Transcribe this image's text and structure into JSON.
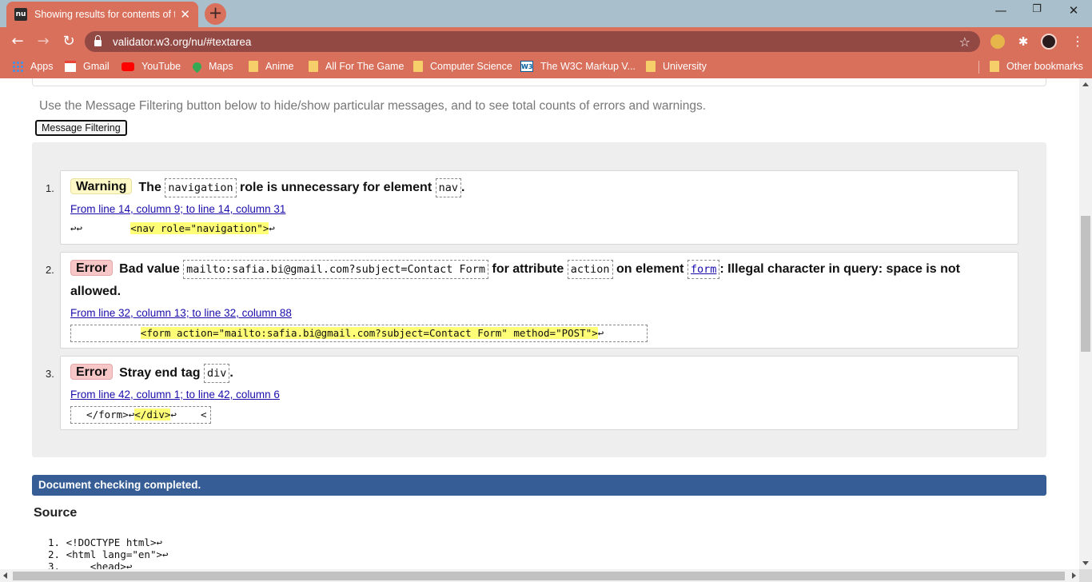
{
  "browser": {
    "tab_title": "Showing results for contents of text-input area",
    "tab_favicon_text": "nu",
    "url": "validator.w3.org/nu/#textarea",
    "bookmarks": [
      {
        "label": "Apps",
        "icon": "apps-grid-icon"
      },
      {
        "label": "Gmail",
        "icon": "gmail-icon"
      },
      {
        "label": "YouTube",
        "icon": "youtube-icon"
      },
      {
        "label": "Maps",
        "icon": "maps-icon"
      },
      {
        "label": "Anime",
        "icon": "folder-icon"
      },
      {
        "label": "All For The Game",
        "icon": "folder-icon"
      },
      {
        "label": "Computer Science",
        "icon": "folder-icon"
      },
      {
        "label": "The W3C Markup V...",
        "icon": "w3c-icon"
      },
      {
        "label": "University",
        "icon": "folder-icon"
      }
    ],
    "other_bookmarks": "Other bookmarks",
    "w3_icon_text": "W3",
    "colors": {
      "tabbar": "#a9bfcc",
      "chrome_accent": "#d9705c",
      "omnibox": "#924843"
    }
  },
  "page": {
    "intro_text": "Use the Message Filtering button below to hide/show particular messages, and to see total counts of errors and warnings.",
    "filter_button": "Message Filtering",
    "messages": [
      {
        "num": "1.",
        "type": "Warning",
        "text_1": "The",
        "code_1": "navigation",
        "text_2": "role is unnecessary for element",
        "code_2": "nav",
        "text_3": ".",
        "location": "From line 14, column 9; to line 14, column 31",
        "extract_pre": "↩↩        ",
        "extract_hl": "<nav role=\"navigation\">",
        "extract_post": "↩"
      },
      {
        "num": "2.",
        "type": "Error",
        "text_1": "Bad value",
        "code_1": "mailto:safia.bi@gmail.com?subject=Contact Form",
        "text_2": "for attribute",
        "code_2": "action",
        "text_3": "on element",
        "code_3": "form",
        "text_4": ": Illegal character in query: space is not allowed.",
        "location": "From line 32, column 13; to line 32, column 88",
        "extract_pre": "           ",
        "extract_hl": "<form action=\"mailto:safia.bi@gmail.com?subject=Contact Form\" method=\"POST\">",
        "extract_post": "↩"
      },
      {
        "num": "3.",
        "type": "Error",
        "text_1": "Stray end tag",
        "code_1": "div",
        "text_2": ".",
        "location": "From line 42, column 1; to line 42, column 6",
        "extract_pre": "  </form>↩",
        "extract_hl": "</div>",
        "extract_post": "↩    <"
      }
    ],
    "done_text": "Document checking completed.",
    "source_heading": "Source",
    "source_lines": [
      {
        "num": "1.",
        "code": "<!DOCTYPE html>↩"
      },
      {
        "num": "2.",
        "code": "<html lang=\"en\">↩"
      },
      {
        "num": "3.",
        "code": "    <head>↩"
      }
    ],
    "colors": {
      "warning_badge": "#fff9c7",
      "error_badge": "#f7c7c7",
      "done_bar": "#365d95",
      "highlight": "#ffff77"
    }
  }
}
